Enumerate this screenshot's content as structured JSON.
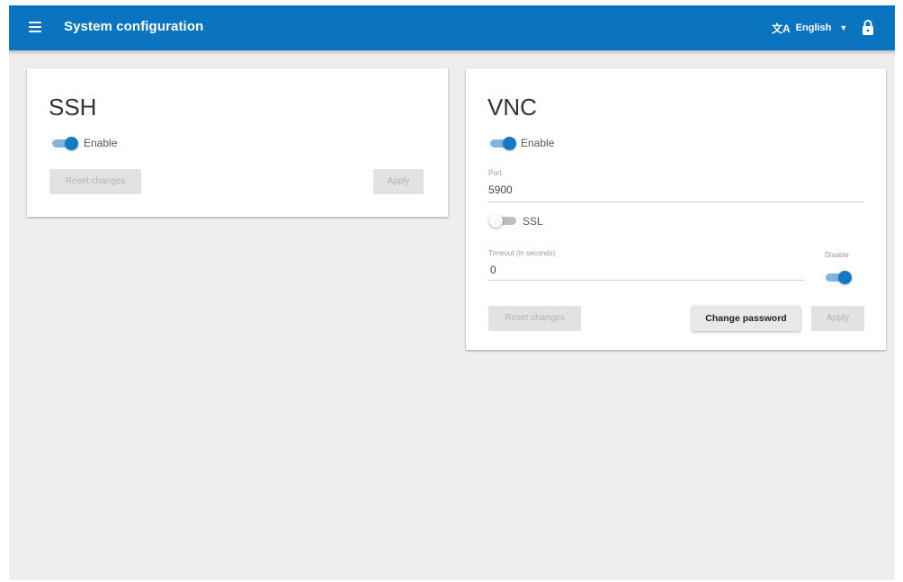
{
  "header": {
    "title": "System configuration",
    "language_icon": "translate-icon",
    "language": "English",
    "lock_icon": "lock-icon"
  },
  "ssh": {
    "title": "SSH",
    "enable_label": "Enable",
    "enabled": true,
    "reset_label": "Reset changes",
    "apply_label": "Apply"
  },
  "vnc": {
    "title": "VNC",
    "enable_label": "Enable",
    "enabled": true,
    "port_label": "Port",
    "port_value": "5900",
    "ssl_label": "SSL",
    "ssl_enabled": false,
    "timeout_label": "Timeout (in seconds)",
    "timeout_value": "0",
    "disable_label": "Disable",
    "disable_enabled": true,
    "reset_label": "Reset changes",
    "change_password_label": "Change password",
    "apply_label": "Apply"
  },
  "colors": {
    "appbar": "#0b74c0",
    "toggle_on": "#1379c2",
    "background": "#eeeeee"
  }
}
